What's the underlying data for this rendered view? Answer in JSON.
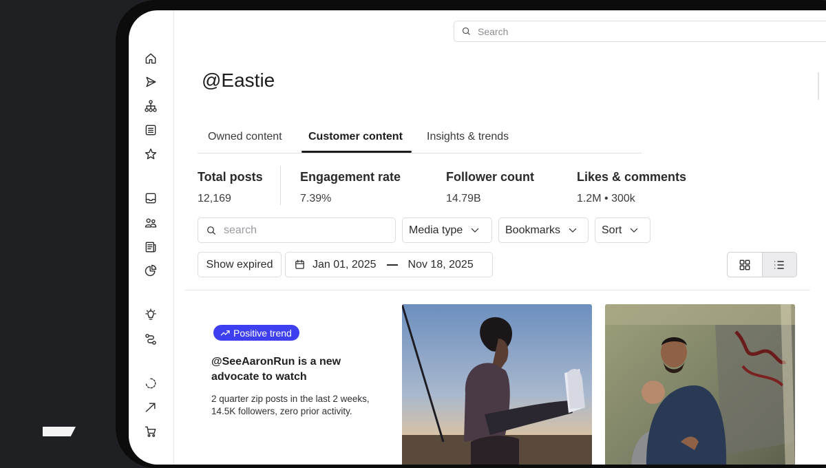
{
  "header": {
    "search_placeholder": "Search",
    "account_title": "@Eastie"
  },
  "sidebar": {
    "icons": [
      "home-icon",
      "send-icon",
      "hierarchy-icon",
      "list-icon",
      "star-icon",
      "inbox-icon",
      "people-icon",
      "newspaper-icon",
      "pie-chart-icon",
      "lightbulb-icon",
      "route-icon",
      "loading-icon",
      "trend-arrow-icon",
      "cart-icon"
    ]
  },
  "tabs": [
    {
      "label": "Owned content",
      "active": false
    },
    {
      "label": "Customer content",
      "active": true
    },
    {
      "label": "Insights & trends",
      "active": false
    }
  ],
  "stats": [
    {
      "label": "Total posts",
      "value": "12,169"
    },
    {
      "label": "Engagement rate",
      "value": "7.39%"
    },
    {
      "label": "Follower count",
      "value": "14.79B"
    },
    {
      "label": "Likes & comments",
      "value": "1.2M • 300k"
    }
  ],
  "filters": {
    "search_placeholder": "search",
    "media_type": "Media type",
    "bookmarks": "Bookmarks",
    "sort": "Sort",
    "show_expired": "Show expired",
    "date_start": "Jan 01, 2025",
    "date_end": "Nov 18, 2025",
    "view_mode": "list"
  },
  "insight_card": {
    "badge": "Positive trend",
    "title": "@SeeAaronRun is a new advocate to watch",
    "description": "2 quarter zip posts in the last 2 weeks, 14.5K followers, zero prior activity."
  },
  "colors": {
    "accent": "#3f3ff2",
    "background": "#1f2023",
    "device_frame": "#0c0c0d"
  }
}
